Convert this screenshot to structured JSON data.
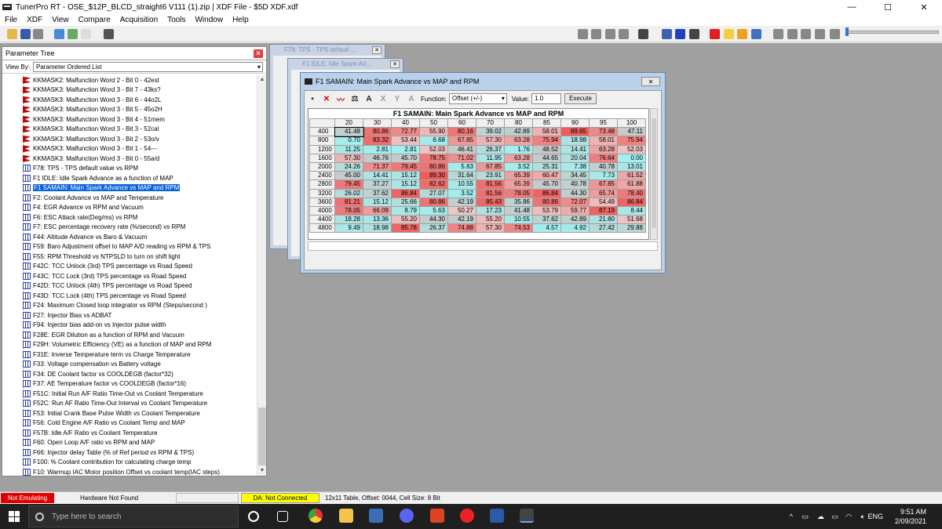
{
  "window": {
    "title": "TunerPro RT - OSE_$12P_BLCD_straight6 V111 (1).zip | XDF File - $5D XDF.xdf",
    "minimize": "—",
    "maximize": "☐",
    "close": "✕"
  },
  "menu": [
    "File",
    "XDF",
    "View",
    "Compare",
    "Acquisition",
    "Tools",
    "Window",
    "Help"
  ],
  "parameter_tree": {
    "title": "Parameter Tree",
    "view_by_label": "View By:",
    "view_by_value": "Parameter Ordered List",
    "items": [
      {
        "label": "KKMASK2: Malfunction Word 2 - Bit 0 - 42est",
        "icon": "flag"
      },
      {
        "label": "KKMASK3: Malfunction Word 3 - Bit 7 - 43ks?",
        "icon": "flag"
      },
      {
        "label": "KKMASK3: Malfunction Word 3 - Bit 6 - 44o2L",
        "icon": "flag"
      },
      {
        "label": "KKMASK3: Malfunction Word 3 - Bit 5 - 45o2H",
        "icon": "flag"
      },
      {
        "label": "KKMASK3: Malfunction Word 3 - Bit 4 - 51mem",
        "icon": "flag"
      },
      {
        "label": "KKMASK3: Malfunction Word 3 - Bit 3 - 52cal",
        "icon": "flag"
      },
      {
        "label": "KKMASK3: Malfunction Word 3 - Bit 2 - 53o/v",
        "icon": "flag"
      },
      {
        "label": "KKMASK3: Malfunction Word 3 - Bit 1 - 54---",
        "icon": "flag"
      },
      {
        "label": "KKMASK3: Malfunction Word 3 - Bit 0 - 55a/d",
        "icon": "flag"
      },
      {
        "label": "F78: TPS - TPS default value vs RPM",
        "icon": "table"
      },
      {
        "label": "F1 IDLE: Idle Spark Advance as a function of MAP",
        "icon": "table"
      },
      {
        "label": "F1 SAMAIN: Main Spark Advance vs MAP and RPM",
        "icon": "table",
        "selected": true
      },
      {
        "label": "F2: Coolant Advance vs MAP and Temperature",
        "icon": "table"
      },
      {
        "label": "F4: EGR Advance vs RPM and Vacuum",
        "icon": "table"
      },
      {
        "label": "F6: ESC Attack rate(Deg/ms) vs RPM",
        "icon": "table"
      },
      {
        "label": "F7: ESC percentage recovery rate (%/second) vs RPM",
        "icon": "table"
      },
      {
        "label": "F44: Altitude Advance vs Baro & Vacuum",
        "icon": "table"
      },
      {
        "label": "F59: Baro Adjustment offset to MAP A/D reading vs RPM & TPS",
        "icon": "table"
      },
      {
        "label": "F55:  RPM Threshold vs NTPSLD to turn on shift light",
        "icon": "table"
      },
      {
        "label": "F42C: TCC Unlock (3rd) TPS percentage vs Road Speed",
        "icon": "table"
      },
      {
        "label": "F43C: TCC Lock (3rd) TPS percentage vs Road Speed",
        "icon": "table"
      },
      {
        "label": "F42D: TCC Unlock (4th) TPS percentage vs Road Speed",
        "icon": "table"
      },
      {
        "label": "F43D: TCC Lock (4th) TPS percentage vs Road Speed",
        "icon": "table"
      },
      {
        "label": "F24: Maximum Closed loop integrator vs RPM (Steps/second )",
        "icon": "table"
      },
      {
        "label": "F27: Injector Bias vs ADBAT",
        "icon": "table"
      },
      {
        "label": "F94: Injector bias add-on vs Injector pulse width",
        "icon": "table"
      },
      {
        "label": "F28E: EGR Dilution as a function of RPM and Vacuum",
        "icon": "table"
      },
      {
        "label": "F29H: Volumetric Efficiency (VE) as a function of MAP and RPM",
        "icon": "table"
      },
      {
        "label": "F31E: Inverse Temperature term vs Charge Temperature",
        "icon": "table"
      },
      {
        "label": "F33: Voltage compensation vs Battery voltage",
        "icon": "table"
      },
      {
        "label": "F34: DE Coolant factor vs COOLDEGB (factor*32)",
        "icon": "table"
      },
      {
        "label": "F37: AE Temperature factor vs COOLDEGB (factor*16)",
        "icon": "table"
      },
      {
        "label": "F51C: Initial Run A/F Ratio Time-Out vs Coolant Temperature",
        "icon": "table"
      },
      {
        "label": "F52C: Run AF Ratio Time-Out Interval vs Coolant Temperature",
        "icon": "table"
      },
      {
        "label": "F53: Initial Crank Base Pulse Width vs Coolant Temperature",
        "icon": "table"
      },
      {
        "label": "F56: Cold Engine A/F Ratio vs Coolant Temp and MAP",
        "icon": "table"
      },
      {
        "label": "F57B: Idle A/F Ratio vs Coolant Temperature",
        "icon": "table"
      },
      {
        "label": "F60: Open Loop A/F ratio vs RPM and MAP",
        "icon": "table"
      },
      {
        "label": "F66: Injector delay Table (% of Ref period vs RPM & TPS)",
        "icon": "table"
      },
      {
        "label": "F100: % Coolant contribution for calculating charge temp",
        "icon": "table"
      },
      {
        "label": "F10:  Warmup IAC Motor position Offset vs coolant temp(IAC steps)",
        "icon": "table"
      }
    ]
  },
  "bg_windows": [
    {
      "title": "F78: TPS - TPS default ..."
    },
    {
      "title": "F1 IDLE: Idle Spark Ad..."
    }
  ],
  "table_window": {
    "title": "F1 SAMAIN: Main Spark Advance vs MAP and RPM",
    "function_label": "Function:",
    "function_value": "Offset (+/-)",
    "value_label": "Value:",
    "value_value": "1.0",
    "execute_label": "Execute",
    "grid_title": "F1 SAMAIN: Main Spark Advance vs MAP and RPM",
    "columns": [
      "20",
      "30",
      "40",
      "50",
      "60",
      "70",
      "80",
      "85",
      "90",
      "95",
      "100"
    ],
    "rows": [
      {
        "rpm": "400",
        "cells": [
          "41.48",
          "80.86",
          "72.77",
          "55.90",
          "80.16",
          "39.02",
          "42.89",
          "58.01",
          "89.65",
          "73.48",
          "47.11"
        ]
      },
      {
        "rpm": "800",
        "cells": [
          "0.70",
          "83.32",
          "53.44",
          "6.68",
          "67.85",
          "57.30",
          "63.28",
          "75.94",
          "18.98",
          "58.01",
          "75.94"
        ]
      },
      {
        "rpm": "1200",
        "cells": [
          "11.25",
          "2.81",
          "2.81",
          "52.03",
          "46.41",
          "26.37",
          "1.76",
          "48.52",
          "14.41",
          "63.28",
          "52.03"
        ]
      },
      {
        "rpm": "1600",
        "cells": [
          "57.30",
          "46.76",
          "45.70",
          "78.75",
          "71.02",
          "11.95",
          "63.28",
          "44.65",
          "20.04",
          "76.64",
          "0.00"
        ]
      },
      {
        "rpm": "2000",
        "cells": [
          "24.26",
          "71.37",
          "79.45",
          "80.86",
          "5.63",
          "67.85",
          "3.52",
          "25.31",
          "7.38",
          "40.78",
          "13.01"
        ]
      },
      {
        "rpm": "2400",
        "cells": [
          "45.00",
          "14.41",
          "15.12",
          "89.30",
          "31.64",
          "23.91",
          "65.39",
          "60.47",
          "34.45",
          "7.73",
          "61.52"
        ]
      },
      {
        "rpm": "2800",
        "cells": [
          "79.45",
          "37.27",
          "15.12",
          "82.62",
          "10.55",
          "81.56",
          "65.39",
          "45.70",
          "40.78",
          "67.85",
          "61.88"
        ]
      },
      {
        "rpm": "3200",
        "cells": [
          "26.02",
          "37.62",
          "86.84",
          "27.07",
          "3.52",
          "81.56",
          "78.05",
          "86.84",
          "44.30",
          "65.74",
          "78.40"
        ]
      },
      {
        "rpm": "3600",
        "cells": [
          "81.21",
          "15.12",
          "25.66",
          "80.86",
          "42.19",
          "85.43",
          "35.86",
          "80.86",
          "72.07",
          "54.49",
          "86.84"
        ]
      },
      {
        "rpm": "4000",
        "cells": [
          "78.05",
          "66.09",
          "8.79",
          "5.63",
          "50.27",
          "17.23",
          "41.48",
          "53.79",
          "59.77",
          "87.19",
          "8.44"
        ]
      },
      {
        "rpm": "4400",
        "cells": [
          "18.28",
          "13.36",
          "55.20",
          "44.30",
          "42.19",
          "55.20",
          "10.55",
          "37.62",
          "42.89",
          "21.80",
          "51.68"
        ]
      },
      {
        "rpm": "4800",
        "cells": [
          "9.49",
          "18.98",
          "85.78",
          "26.37",
          "74.88",
          "57.30",
          "74.53",
          "4.57",
          "4.92",
          "27.42",
          "29.88"
        ]
      }
    ]
  },
  "status_bar": {
    "emulation": "Not Emulating",
    "hardware": "Hardware Not Found",
    "da": "DA: Not Connected",
    "info": "12x11 Table, Offset: 0044,  Cell Size: 8 Bit"
  },
  "taskbar": {
    "search_placeholder": "Type here to search",
    "language": "ENG",
    "time": "9:51 AM",
    "date": "2/09/2021"
  },
  "colors": {
    "cell_low": "#a8eef0",
    "cell_mid": "#c8c8c8",
    "cell_high": "#ee6060",
    "emul_red": "#e00000",
    "da_yellow": "#ffff00",
    "select_blue": "#0a64d8"
  }
}
